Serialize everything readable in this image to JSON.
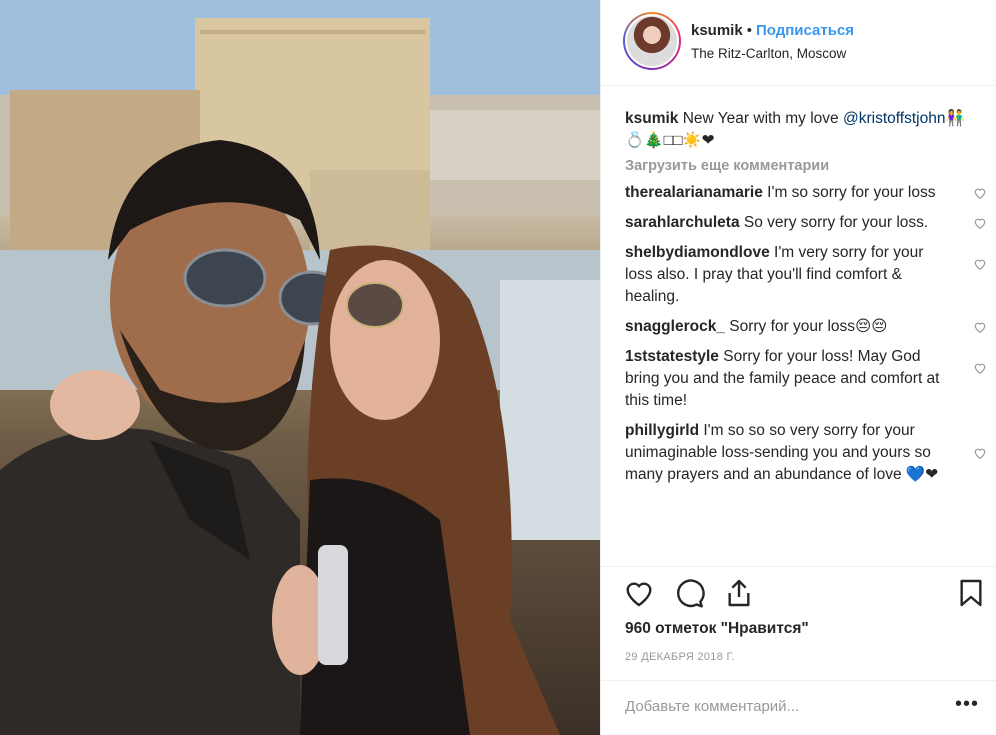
{
  "post": {
    "username": "ksumik",
    "separator": "•",
    "follow_label": "Подписаться",
    "location": "The Ritz-Carlton, Moscow"
  },
  "caption": {
    "username": "ksumik",
    "text": "New Year with my love",
    "mention": "@kristoffstjohn",
    "emoji": "👫💍🎄□□☀️❤"
  },
  "load_more_label": "Загрузить еще комментарии",
  "comments": [
    {
      "user": "therealarianamarie",
      "text": "I'm so sorry for your loss"
    },
    {
      "user": "sarahlarchuleta",
      "text": "So very sorry for your loss."
    },
    {
      "user": "shelbydiamondlove",
      "text": "I'm very sorry for your loss also. I pray that you'll find comfort & healing."
    },
    {
      "user": "snagglerock_",
      "text": "Sorry for your loss😔😔"
    },
    {
      "user": "1ststatestyle",
      "text": "Sorry for your loss! May God bring you and the family peace and comfort at this time!"
    },
    {
      "user": "phillygirld",
      "text": "I'm so so so very sorry for your unimaginable loss-sending you and yours so many prayers and an abundance of love 💙❤"
    }
  ],
  "likes_label": "960 отметок \"Нравится\"",
  "date_label": "29 ДЕКАБРЯ 2018 Г.",
  "add_comment_placeholder": "Добавьте комментарий...",
  "more_label": "•••",
  "icons": {
    "like": "heart-icon",
    "comment": "comment-icon",
    "share": "share-icon",
    "save": "bookmark-icon",
    "comment_like": "small-heart-icon"
  },
  "colors": {
    "link": "#3897f0",
    "muted": "#999999",
    "text": "#262626"
  }
}
